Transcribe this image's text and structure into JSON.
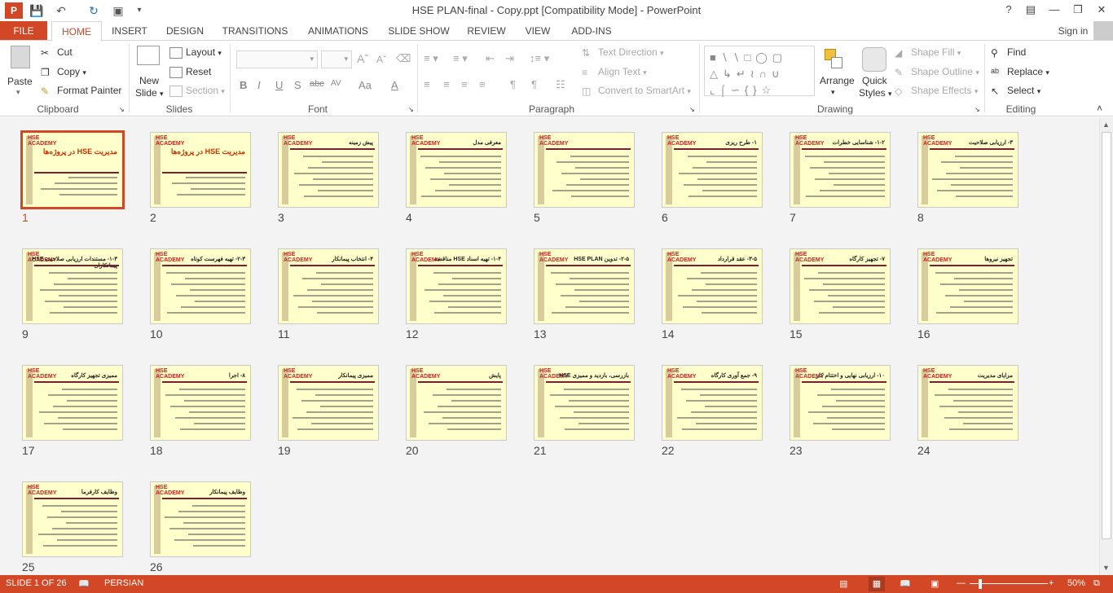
{
  "window": {
    "title": "HSE PLAN-final - Copy.ppt [Compatibility Mode] - PowerPoint",
    "help": "?",
    "sign_in": "Sign in"
  },
  "tabs": [
    "FILE",
    "HOME",
    "INSERT",
    "DESIGN",
    "TRANSITIONS",
    "ANIMATIONS",
    "SLIDE SHOW",
    "REVIEW",
    "VIEW",
    "ADD-INS"
  ],
  "ribbon": {
    "clipboard": {
      "label": "Clipboard",
      "paste": "Paste",
      "cut": "Cut",
      "copy": "Copy",
      "format_painter": "Format Painter"
    },
    "slides": {
      "label": "Slides",
      "new_slide_1": "New",
      "new_slide_2": "Slide",
      "layout": "Layout",
      "reset": "Reset",
      "section": "Section"
    },
    "font": {
      "label": "Font",
      "bold": "B",
      "italic": "I",
      "underline": "U",
      "shadow": "S",
      "strike": "abc",
      "spacing": "AV",
      "case": "Aa",
      "color": "A"
    },
    "paragraph": {
      "label": "Paragraph",
      "text_direction": "Text Direction",
      "align_text": "Align Text",
      "convert_smartart": "Convert to SmartArt"
    },
    "drawing": {
      "label": "Drawing",
      "arrange": "Arrange",
      "quick_styles_1": "Quick",
      "quick_styles_2": "Styles",
      "shape_fill": "Shape Fill",
      "shape_outline": "Shape Outline",
      "shape_effects": "Shape Effects"
    },
    "editing": {
      "label": "Editing",
      "find": "Find",
      "replace": "Replace",
      "select": "Select"
    }
  },
  "slides": [
    {
      "n": "1",
      "title": "مدیریت HSE در پروژه‌ها"
    },
    {
      "n": "2",
      "title": "مدیریت HSE در پروژه‌ها"
    },
    {
      "n": "3",
      "title": "پیش زمینه"
    },
    {
      "n": "4",
      "title": "معرفی مدل"
    },
    {
      "n": "5",
      "title": ""
    },
    {
      "n": "6",
      "title": "۱- طرح ریزی"
    },
    {
      "n": "7",
      "title": "۱-۲- شناسایی خطرات"
    },
    {
      "n": "8",
      "title": "۳- ارزیابی صلاحیت"
    },
    {
      "n": "9",
      "title": "۱-۳- مستندات ارزیابی صلاحیت HSE پیمانکاران"
    },
    {
      "n": "10",
      "title": "۲-۳- تهیه فهرست کوتاه"
    },
    {
      "n": "11",
      "title": "۴- انتخاب پیمانکار"
    },
    {
      "n": "12",
      "title": "۱-۴- تهیه اسناد HSE مناقصه"
    },
    {
      "n": "13",
      "title": "۲-۵- تدوین HSE PLAN"
    },
    {
      "n": "14",
      "title": "۳-۵- عقد قرارداد"
    },
    {
      "n": "15",
      "title": "۷- تجهیز کارگاه"
    },
    {
      "n": "16",
      "title": "تجهیز نیروها"
    },
    {
      "n": "17",
      "title": "ممیزی تجهیز کارگاه"
    },
    {
      "n": "18",
      "title": "۸- اجرا"
    },
    {
      "n": "19",
      "title": "ممیزی پیمانکار"
    },
    {
      "n": "20",
      "title": "پایش"
    },
    {
      "n": "21",
      "title": "بازرسی، بازدید و ممیزی HSE"
    },
    {
      "n": "22",
      "title": "۹- جمع آوری کارگاه"
    },
    {
      "n": "23",
      "title": "۱۰- ارزیابی نهایی و اختتام کار"
    },
    {
      "n": "24",
      "title": "مزایای مدیریت"
    },
    {
      "n": "25",
      "title": "وظایف کارفرما"
    },
    {
      "n": "26",
      "title": "وظایف پیمانکار"
    }
  ],
  "slide_logo": "HSE ACADEMY",
  "status": {
    "slide_info": "SLIDE 1 OF 26",
    "language": "PERSIAN",
    "zoom": "50%"
  },
  "colors": {
    "accent": "#d24726",
    "thumb_bg": "#ffffcc"
  }
}
